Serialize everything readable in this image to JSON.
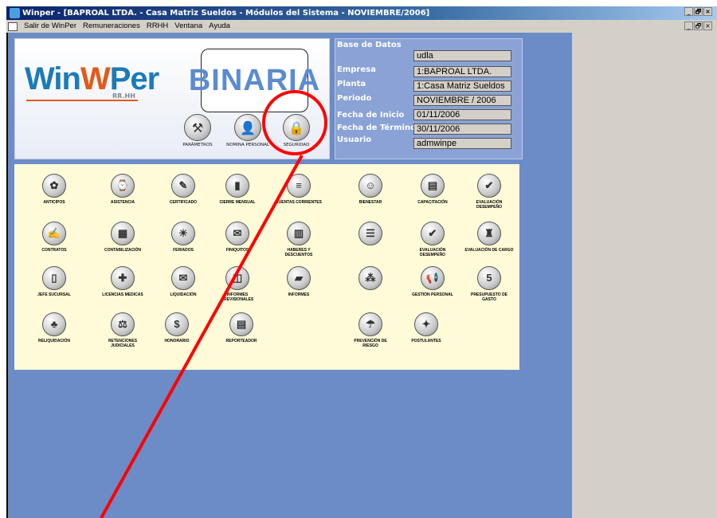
{
  "window": {
    "title": "Winper - [BAPROAL LTDA. - Casa Matriz Sueldos - Módulos del Sistema - NOVIEMBRE/2006]",
    "controls": [
      "_",
      "🗗",
      "×"
    ]
  },
  "menubar": {
    "items": [
      "Salir de WinPer",
      "Remuneraciones",
      "RRHH",
      "Ventana",
      "Ayuda"
    ]
  },
  "logo": {
    "winper_a": "Win",
    "winper_b": "W",
    "winper_c": "Per",
    "winper_sub": "RR.HH",
    "binaria": "BINARIA"
  },
  "top_tools": [
    {
      "label": "PARÁMETROS",
      "icon": "tools-icon",
      "glyph": "⚒"
    },
    {
      "label": "NOMINA PERSONAL",
      "icon": "person-icon",
      "glyph": "👤"
    },
    {
      "label": "SEGURIDAD",
      "icon": "security-icon",
      "glyph": "🔒"
    }
  ],
  "info": {
    "labels": [
      "Base de Datos",
      "Empresa",
      "Planta",
      "Periodo",
      "Fecha de Inicio",
      "Fecha de Término",
      "Usuario"
    ],
    "values": [
      "udla",
      "1:BAPROAL LTDA.",
      "1:Casa Matriz Sueldos",
      "NOVIEMBRE / 2006",
      "01/11/2006",
      "30/11/2006",
      "admwinpe"
    ]
  },
  "modules": [
    {
      "label": "ANTICIPOS",
      "glyph": "✿"
    },
    {
      "label": "ASISTENCIA",
      "glyph": "⌚"
    },
    {
      "label": "CERTIFICADO",
      "glyph": "✎"
    },
    {
      "label": "CIERRE MENSUAL",
      "glyph": "▮"
    },
    {
      "label": "CUENTAS CORRIENTES",
      "glyph": "≡"
    },
    {
      "label": "BIENESTAR",
      "glyph": "☺"
    },
    {
      "label": "CAPACITACIÓN",
      "glyph": "▤"
    },
    {
      "label": "EVALUACIÓN DESEMPEÑO",
      "glyph": "✔"
    },
    {
      "label": "CONTRATOS",
      "glyph": "✍"
    },
    {
      "label": "CONTABILIZACIÓN",
      "glyph": "▦"
    },
    {
      "label": "FERIADOS",
      "glyph": "☀"
    },
    {
      "label": "FINIQUITOS",
      "glyph": "✉"
    },
    {
      "label": "HABERES Y DESCUENTOS",
      "glyph": "▥"
    },
    {
      "label": "",
      "glyph": "☰"
    },
    {
      "label": "EVALUACIÓN DESEMPEÑO",
      "glyph": "✔"
    },
    {
      "label": "EVALUACIÓN DE CARGO",
      "glyph": "♜"
    },
    {
      "label": "JEFE SUCURSAL",
      "glyph": "▯"
    },
    {
      "label": "LICENCIAS MEDICAS",
      "glyph": "✚"
    },
    {
      "label": "LIQUIDACIÓN",
      "glyph": "✉"
    },
    {
      "label": "INFORMES PREVISIONALES",
      "glyph": "◫"
    },
    {
      "label": "INFORMES",
      "glyph": "▰"
    },
    {
      "label": "",
      "glyph": "⁂"
    },
    {
      "label": "GESTIÓN PERSONAL",
      "glyph": "📢"
    },
    {
      "label": "PRESUPUESTO DE GASTO",
      "glyph": "5"
    },
    {
      "label": "RELIQUIDACIÓN",
      "glyph": "♣"
    },
    {
      "label": "RETENCIONES JUDICIALES",
      "glyph": "⚖"
    },
    {
      "label": "HONORARIO",
      "glyph": "$"
    },
    {
      "label": "REPORTEADOR",
      "glyph": "▤"
    },
    {
      "label": "PREVENCIÓN DE RIESGO",
      "glyph": "☂"
    },
    {
      "label": "POSTULANTES",
      "glyph": "✦"
    }
  ],
  "colors": {
    "client_bg": "#6b8cc7",
    "modules_bg": "#fffbd8",
    "annotation": "#ff0000"
  }
}
